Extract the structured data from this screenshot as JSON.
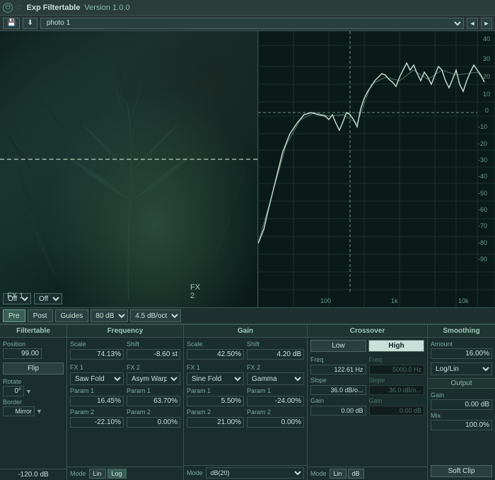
{
  "titlebar": {
    "title": "Exp Filtertable",
    "version": "Version 1.0.0"
  },
  "toolbar": {
    "preset": "photo 1",
    "prev_label": "◄",
    "next_label": "►",
    "save_icon": "💾",
    "load_icon": "📂"
  },
  "graph_controls": {
    "pre_label": "Pre",
    "post_label": "Post",
    "guides_label": "Guides",
    "db_range": "80 dB",
    "slope": "4.5 dB/oct",
    "fx1_label": "FX 1",
    "fx1_value": "Off",
    "fx2_label": "FX 2",
    "fx2_value": "Off"
  },
  "panels": {
    "filtertable": {
      "header": "Filtertable",
      "position_label": "Position",
      "position_value": "99.00",
      "flip_label": "Flip",
      "rotate_label": "Rotate",
      "rotate_value": "0°",
      "border_label": "Border",
      "border_value": "Mirror",
      "db_value": "-120.0 dB"
    },
    "frequency": {
      "header": "Frequency",
      "scale_label": "Scale",
      "scale_value": "74.13%",
      "shift_label": "Shift",
      "shift_value": "-8.60 st",
      "fx1_label": "FX 1",
      "fx1_mode": "Saw Fold",
      "fx2_label": "FX 2",
      "fx2_mode": "Asym Warp",
      "param1_fx1_label": "Param 1",
      "param1_fx1_value": "16.45%",
      "param1_fx2_label": "Param 1",
      "param1_fx2_value": "63.70%",
      "param2_fx1_label": "Param 2",
      "param2_fx1_value": "-22.10%",
      "param2_fx2_label": "Param 2",
      "param2_fx2_value": "0.00%",
      "mode_label": "Mode",
      "lin_label": "Lin",
      "log_label": "Log"
    },
    "gain": {
      "header": "Gain",
      "scale_label": "Scale",
      "scale_value": "42.50%",
      "shift_label": "Shift",
      "shift_value": "4.20 dB",
      "fx1_label": "FX 1",
      "fx1_mode": "Sine Fold",
      "fx2_label": "FX 2",
      "fx2_mode": "Gamma",
      "param1_fx1_label": "Param 1",
      "param1_fx1_value": "5.50%",
      "param1_fx2_label": "Param 1",
      "param1_fx2_value": "-24.00%",
      "param2_fx1_label": "Param 2",
      "param2_fx1_value": "21.00%",
      "param2_fx2_label": "Param 2",
      "param2_fx2_value": "0.00%",
      "mode_label": "Mode",
      "db20_label": "dB(20)"
    },
    "crossover": {
      "header": "Crossover",
      "low_label": "Low",
      "high_label": "High",
      "freq_low_label": "Freq",
      "freq_low_value": "122.61 Hz",
      "freq_high_label": "Freq",
      "freq_high_value": "5000.0 Hz",
      "slope_low_label": "Slope",
      "slope_low_value": "36.0 dB/o...",
      "slope_high_label": "Slope",
      "slope_high_value": "36.0 dB/o...",
      "gain_low_label": "Gain",
      "gain_low_value": "0.00 dB",
      "gain_high_label": "Gain",
      "gain_high_value": "0.00 dB",
      "mode_label": "Mode",
      "lin_label": "Lin",
      "db_label": "dB"
    },
    "smoothing": {
      "header": "Smoothing",
      "amount_label": "Amount",
      "amount_value": "16.00%",
      "log_lin_label": "Log/Lin"
    },
    "output": {
      "header": "Output",
      "gain_label": "Gain",
      "gain_value": "0.00 dB",
      "mix_label": "Mix",
      "mix_value": "100.0%",
      "soft_clip_label": "Soft Clip"
    }
  },
  "freq_labels": {
    "hz100": "100",
    "hz1k": "1k",
    "hz10k": "10k"
  },
  "db_labels": {
    "db40": "40",
    "db30": "30",
    "db20": "20",
    "db10": "10",
    "db0": "0",
    "db_n10": "-10",
    "db_n20": "-20",
    "db_n30": "-30",
    "db_n40": "-40",
    "db_n50": "-50",
    "db_n60": "-60",
    "db_n70": "-70",
    "db_n80": "-80",
    "db_n90": "-90"
  },
  "colors": {
    "bg": "#1a2e2e",
    "panel_bg": "#1e3030",
    "border": "#3a5550",
    "accent": "#7abba8",
    "text": "#c8e0d8",
    "dim": "#4a7060",
    "active_bg": "#c8e0d8",
    "active_text": "#0a2020",
    "graph_line": "#e0f0e0",
    "graph_grid": "#2a4a40"
  }
}
